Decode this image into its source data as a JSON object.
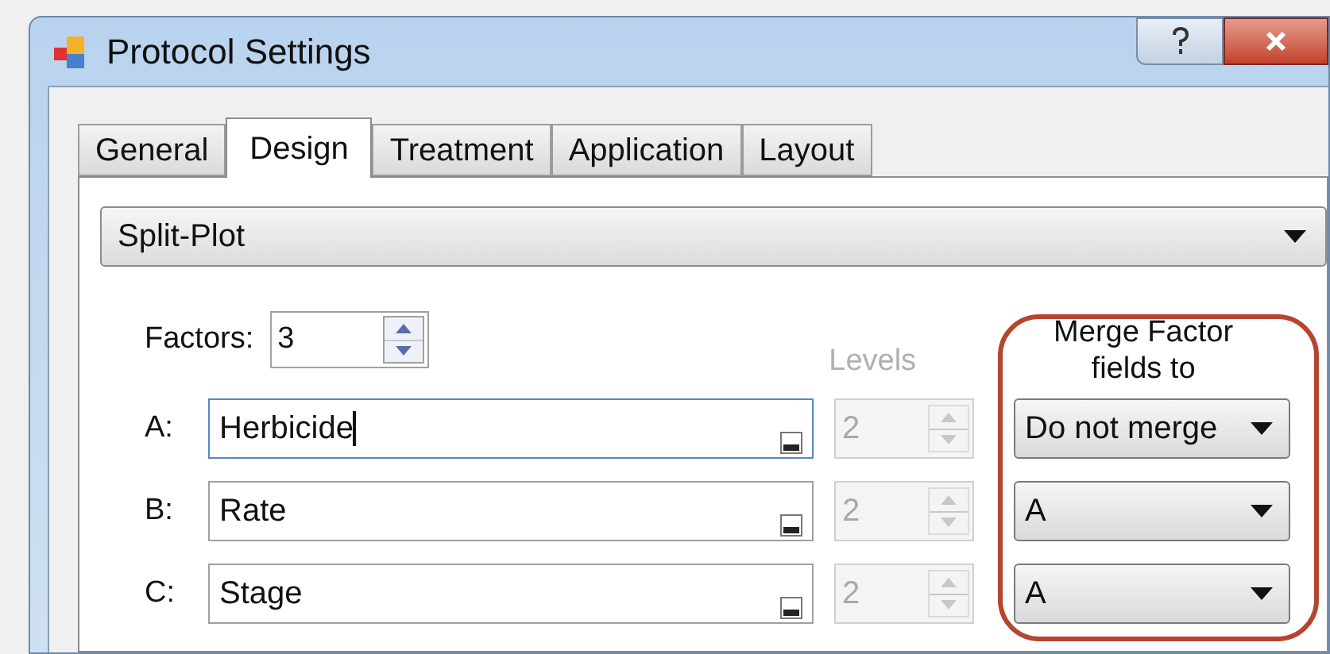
{
  "window": {
    "title": "Protocol Settings"
  },
  "tabs": [
    {
      "label": "General",
      "selected": false
    },
    {
      "label": "Design",
      "selected": true
    },
    {
      "label": "Treatment",
      "selected": false
    },
    {
      "label": "Application",
      "selected": false
    },
    {
      "label": "Layout",
      "selected": false
    }
  ],
  "design": {
    "design_type": "Split-Plot",
    "factors_label": "Factors:",
    "factors_value": "3",
    "levels_header": "Levels",
    "merge_header": "Merge Factor fields to",
    "rows": [
      {
        "label": "A:",
        "name": "Herbicide",
        "focused": true,
        "levels": "2",
        "levels_disabled": true,
        "merge": "Do not merge"
      },
      {
        "label": "B:",
        "name": "Rate",
        "focused": false,
        "levels": "2",
        "levels_disabled": true,
        "merge": "A"
      },
      {
        "label": "C:",
        "name": "Stage",
        "focused": false,
        "levels": "2",
        "levels_disabled": true,
        "merge": "A"
      }
    ]
  }
}
